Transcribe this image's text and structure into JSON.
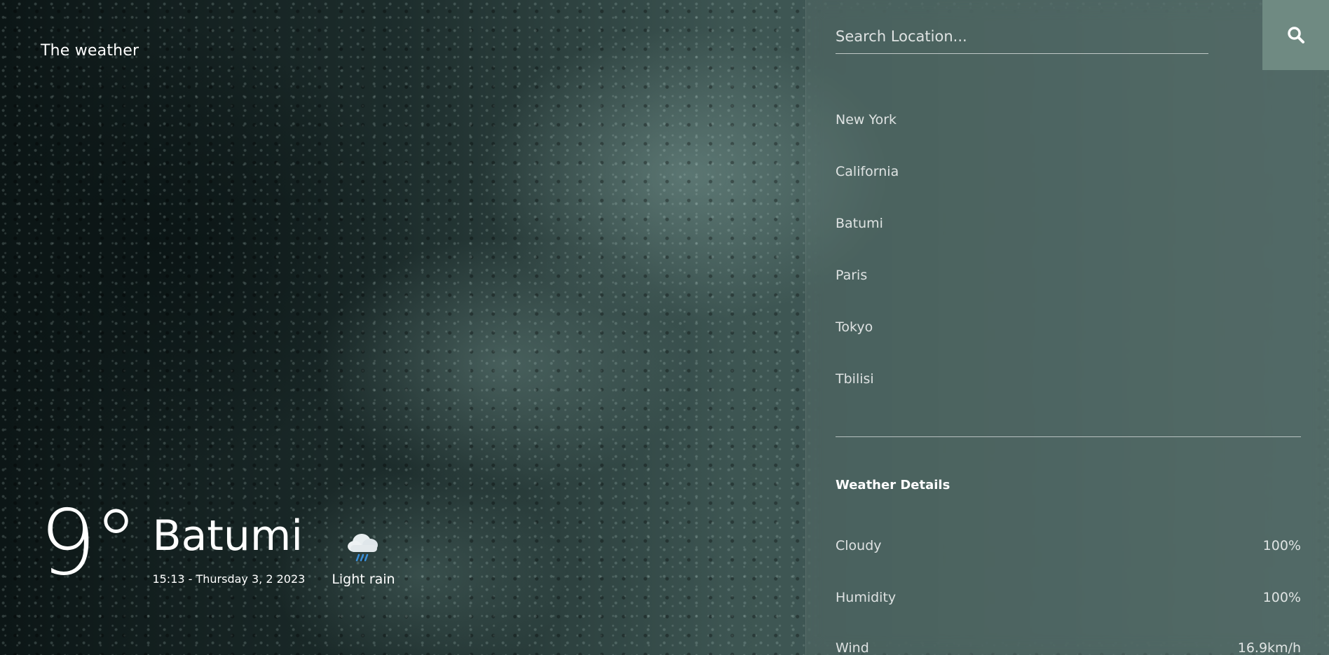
{
  "brand": "The weather",
  "current": {
    "temperature": "9°",
    "city": "Batumi",
    "datetime": "15:13 - Thursday 3, 2 2023",
    "condition": "Light rain",
    "condition_icon": "rain-cloud-icon"
  },
  "search": {
    "placeholder": "Search Location...",
    "value": "",
    "button_icon": "search-icon"
  },
  "locations": [
    "New York",
    "California",
    "Batumi",
    "Paris",
    "Tokyo",
    "Tbilisi"
  ],
  "details": {
    "title": "Weather Details",
    "rows": [
      {
        "label": "Cloudy",
        "value": "100%"
      },
      {
        "label": "Humidity",
        "value": "100%"
      },
      {
        "label": "Wind",
        "value": "16.9km/h"
      }
    ]
  },
  "colors": {
    "search_button": "#6f8a82",
    "text": "#ffffff"
  }
}
